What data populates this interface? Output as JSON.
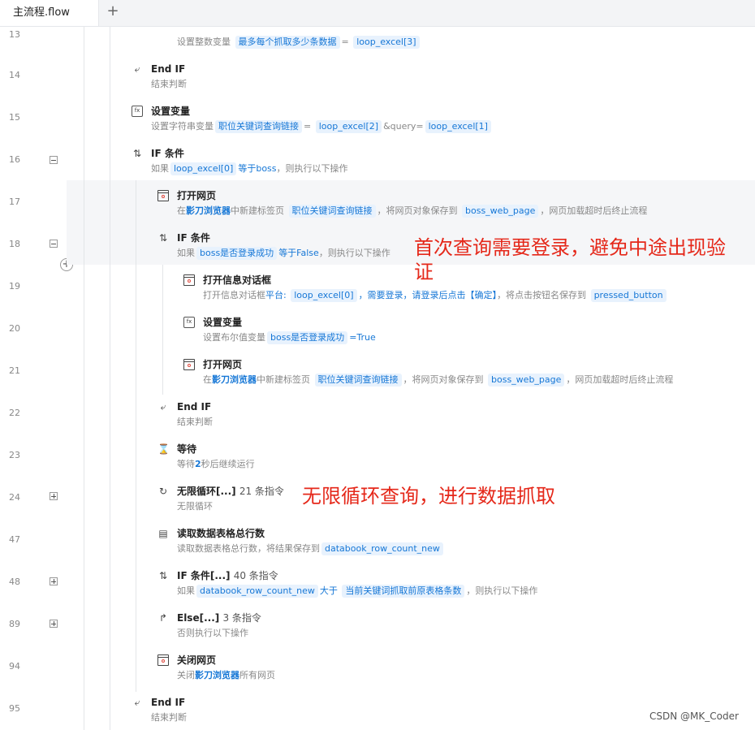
{
  "tabs": {
    "active": "主流程.flow",
    "add": "+"
  },
  "lines": [
    "13",
    "14",
    "15",
    "16",
    "17",
    "18",
    "19",
    "20",
    "21",
    "22",
    "23",
    "24",
    "47",
    "48",
    "89",
    "94",
    "95"
  ],
  "steps": {
    "s13": {
      "desc_a": "设置整数变量",
      "desc_b": "最多每个抓取多少条数据",
      "desc_c": "=",
      "desc_d": "loop_excel[3]"
    },
    "s14": {
      "title": "End IF",
      "desc": "结束判断"
    },
    "s15": {
      "title": "设置变量",
      "desc_a": "设置字符串变量",
      "desc_b": "职位关键词查询链接",
      "desc_c": "=",
      "desc_d": "loop_excel[2]",
      "desc_e": "&query=",
      "desc_f": "loop_excel[1]"
    },
    "s16": {
      "title": "IF 条件",
      "desc_a": "如果",
      "desc_b": "loop_excel[0]",
      "desc_c": "等于boss",
      "desc_d": "，则执行以下操作"
    },
    "s17": {
      "title": "打开网页",
      "desc_a": "在",
      "desc_b": "影刀浏览器",
      "desc_c": "中新建标签页",
      "desc_d": "职位关键词查询链接",
      "desc_e": "，将网页对象保存到",
      "desc_f": "boss_web_page",
      "desc_g": "，网页加载超时后终止流程"
    },
    "s18": {
      "title": "IF 条件",
      "desc_a": "如果",
      "desc_b": "boss是否登录成功",
      "desc_c": "等于False",
      "desc_d": "，则执行以下操作"
    },
    "s19": {
      "title": "打开信息对话框",
      "desc_a": "打开信息对话框",
      "desc_b": "平台:",
      "desc_c": "loop_excel[0]",
      "desc_d": "，需要登录，请登录后点击【确定】",
      "desc_e": "，将点击按钮名保存到",
      "desc_f": "pressed_button"
    },
    "s20": {
      "title": "设置变量",
      "desc_a": "设置布尔值变量",
      "desc_b": "boss是否登录成功",
      "desc_c": "=True"
    },
    "s21": {
      "title": "打开网页",
      "desc_a": "在",
      "desc_b": "影刀浏览器",
      "desc_c": "中新建标签页",
      "desc_d": "职位关键词查询链接",
      "desc_e": "，将网页对象保存到",
      "desc_f": "boss_web_page",
      "desc_g": "，网页加载超时后终止流程"
    },
    "s22": {
      "title": "End IF",
      "desc": "结束判断"
    },
    "s23": {
      "title": "等待",
      "desc_a": "等待",
      "desc_b": "2",
      "desc_c": "秒后继续运行"
    },
    "s24": {
      "title": "无限循环[...]",
      "count": "21 条指令",
      "desc": "无限循环"
    },
    "s47": {
      "title": "读取数据表格总行数",
      "desc_a": "读取数据表格总行数，将结果保存到",
      "desc_b": "databook_row_count_new"
    },
    "s48": {
      "title": "IF 条件[...]",
      "count": "40 条指令",
      "desc_a": "如果",
      "desc_b": "databook_row_count_new",
      "desc_c": "大于",
      "desc_d": "当前关键词抓取前原表格条数",
      "desc_e": "，则执行以下操作"
    },
    "s89": {
      "title": "Else[...]",
      "count": "3 条指令",
      "desc": "否则执行以下操作"
    },
    "s94": {
      "title": "关闭网页",
      "desc_a": "关闭",
      "desc_b": "影刀浏览器",
      "desc_c": "所有网页"
    },
    "s95": {
      "title": "End IF",
      "desc": "结束判断"
    }
  },
  "annotations": {
    "login": "首次查询需要登录，避免中途出现验证",
    "loop": "无限循环查询，进行数据抓取"
  },
  "watermark": "CSDN @MK_Coder",
  "colors": {
    "accent": "#1677d6",
    "annotation": "#e5281a",
    "chip_bg": "#e8f2fd"
  }
}
